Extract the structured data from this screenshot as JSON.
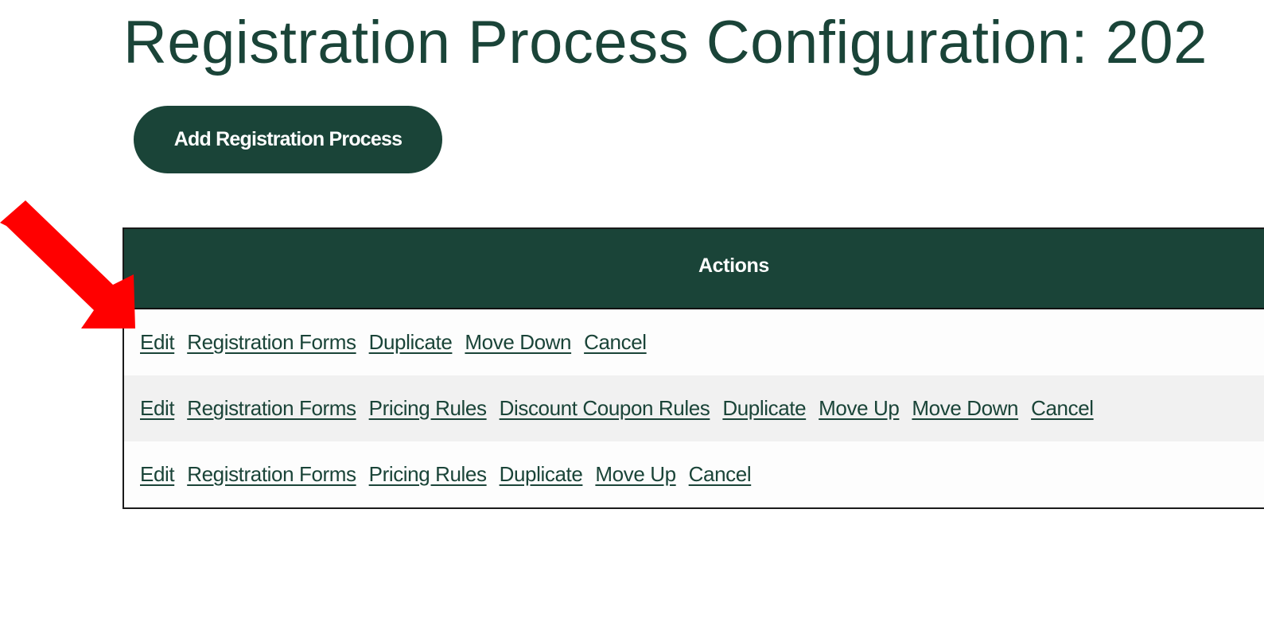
{
  "header": {
    "title": "Registration Process Configuration: 202"
  },
  "toolbar": {
    "add_label": "Add Registration Process"
  },
  "table": {
    "header": "Actions",
    "rows": [
      {
        "links": [
          "Edit",
          "Registration Forms",
          "Duplicate",
          "Move Down",
          "Cancel"
        ]
      },
      {
        "links": [
          "Edit",
          "Registration Forms",
          "Pricing Rules",
          "Discount Coupon Rules",
          "Duplicate",
          "Move Up",
          "Move Down",
          "Cancel"
        ]
      },
      {
        "links": [
          "Edit",
          "Registration Forms",
          "Pricing Rules",
          "Duplicate",
          "Move Up",
          "Cancel"
        ]
      }
    ]
  },
  "annotation": {
    "icon": "red-arrow-icon",
    "color": "#ff0000",
    "points_to": "Edit"
  }
}
